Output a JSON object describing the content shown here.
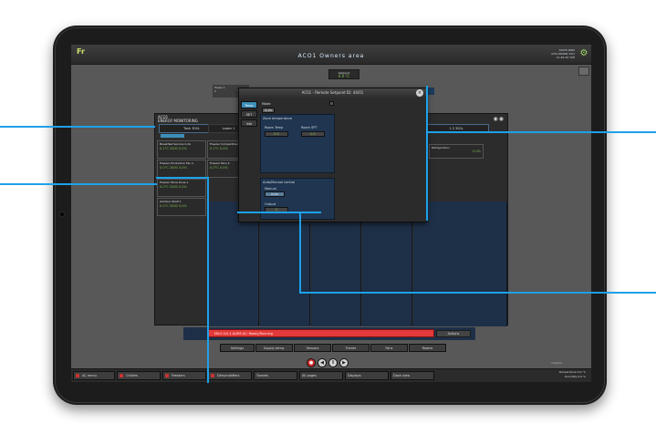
{
  "topbar": {
    "logo": "Fr",
    "title": "ACO1 Owners area",
    "right_lines": [
      "STATS  DIRS",
      "GTS-CRNGN  23/1",
      "11:40:29  TUE"
    ]
  },
  "setpoint": {
    "label": "Setpoint",
    "value": "0.0 °C"
  },
  "ahu_ref": {
    "line1": "Tower 1",
    "line2": "2"
  },
  "main_panel": {
    "title_lines": [
      "ACO1",
      "ENERGY MONITORING"
    ],
    "columns": [
      "Tank 300L",
      "Lower 1",
      "",
      "",
      "1.3 300L"
    ],
    "cards": [
      {
        "title": "Breakfast Service 2.2A",
        "values": "0.1°C  2000  0.0%"
      },
      {
        "title": "Freezer Compartment 2",
        "values": "0.1°C  0.0%"
      },
      {
        "title": "Freezer Production Fan 1",
        "values": "0.0°C  2000  0.0%"
      },
      {
        "title": "Freezer Fans 2",
        "values": "0.0°C  0.0%"
      },
      {
        "title": "Freezer Store Zone 1",
        "values": "0.0°C  2000  0.0%"
      },
      {
        "title": "Outdoor Shelf 1",
        "values": "0.0°C  2000  0.0%"
      }
    ],
    "right_card": {
      "title": "Refrigeration",
      "value": "0.0%"
    }
  },
  "popup": {
    "title": "AC01 - Remote Setpoint  ID: 44/01",
    "tabs": [
      "Temp",
      "SET",
      "Info"
    ],
    "mode_label": "Mode",
    "mode_value": "Auto",
    "zone_title": "Zone temperature",
    "room_temp_label": "Room Temp",
    "room_temp_value": "0.0",
    "room_spt_label": "Room SPT",
    "room_spt_value": "0.0",
    "manual_title": "Auto/Manual control",
    "manual_label": "Manual",
    "manual_value": "Auto",
    "output_label": "Output",
    "output_value": "0"
  },
  "alarm": {
    "text": "Min2   0/4   4   ALRM   AC: Ready/Running",
    "action": "Actions"
  },
  "nav_row1": [
    "Settings",
    "Supply temp.",
    "Sensors",
    "Trends",
    "Fans",
    "Rooms"
  ],
  "bottom_nav": [
    "AC menu",
    "Chillers",
    "Freezers",
    "Dehumidifiers",
    "Tunnels",
    "All pages",
    "Displays",
    "Dash view"
  ],
  "bottom_right": {
    "title": "Outside",
    "lines": [
      "Temperature  0.0 °C",
      "Humidity  0.0 %"
    ]
  }
}
